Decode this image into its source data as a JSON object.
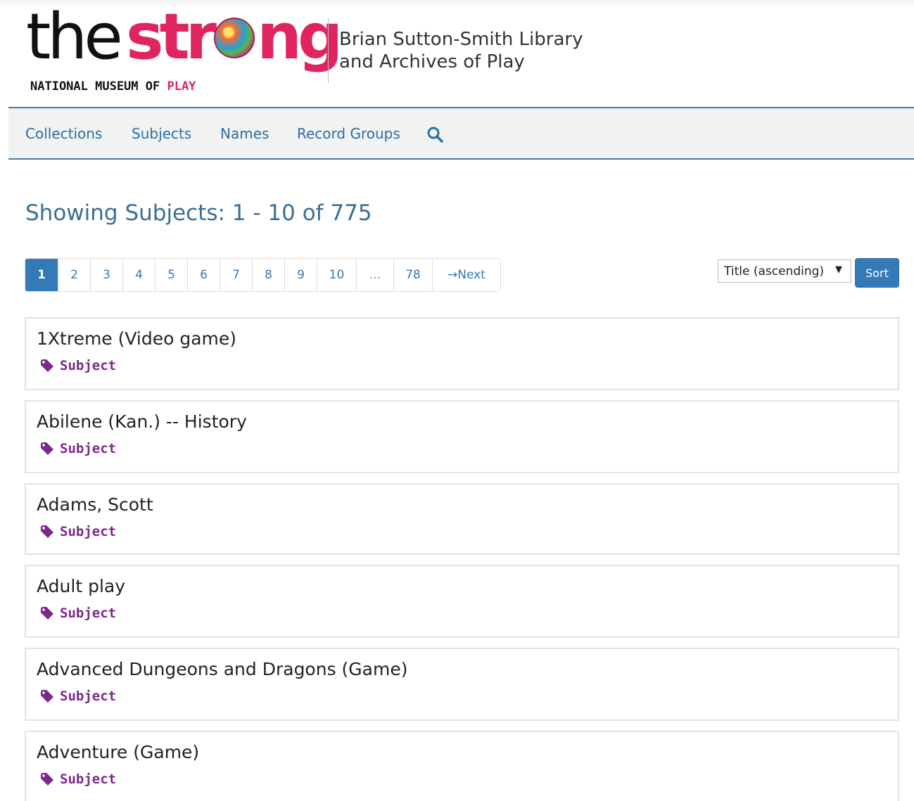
{
  "header": {
    "logo": {
      "the": "the",
      "strong_pre": "str",
      "strong_post": "ng",
      "tagline_main": "NATIONAL MUSEUM OF ",
      "tagline_play": "PLAY"
    },
    "library_line1": "Brian Sutton-Smith Library",
    "library_line2": "and Archives of Play"
  },
  "nav": {
    "items": [
      {
        "label": "Collections"
      },
      {
        "label": "Subjects"
      },
      {
        "label": "Names"
      },
      {
        "label": "Record Groups"
      }
    ],
    "search_icon": "search-icon"
  },
  "results": {
    "title": "Showing Subjects: 1 - 10 of 775"
  },
  "pagination": {
    "pages": [
      {
        "label": "1",
        "active": true
      },
      {
        "label": "2"
      },
      {
        "label": "3"
      },
      {
        "label": "4"
      },
      {
        "label": "5"
      },
      {
        "label": "6"
      },
      {
        "label": "7"
      },
      {
        "label": "8"
      },
      {
        "label": "9"
      },
      {
        "label": "10"
      },
      {
        "label": "..."
      },
      {
        "label": "78"
      },
      {
        "label": "→Next"
      }
    ]
  },
  "sort": {
    "selected": "Title (ascending)",
    "button_label": "Sort"
  },
  "items": [
    {
      "title": "1Xtreme (Video game)",
      "type": "Subject"
    },
    {
      "title": "Abilene (Kan.) -- History",
      "type": "Subject"
    },
    {
      "title": "Adams, Scott",
      "type": "Subject"
    },
    {
      "title": "Adult play",
      "type": "Subject"
    },
    {
      "title": "Advanced Dungeons and Dragons (Game)",
      "type": "Subject"
    },
    {
      "title": "Adventure (Game)",
      "type": "Subject"
    }
  ],
  "colors": {
    "brand_pink": "#e0245e",
    "link_blue": "#337ab7",
    "heading_blue": "#3a6f94",
    "subject_purple": "#7b2a89"
  }
}
